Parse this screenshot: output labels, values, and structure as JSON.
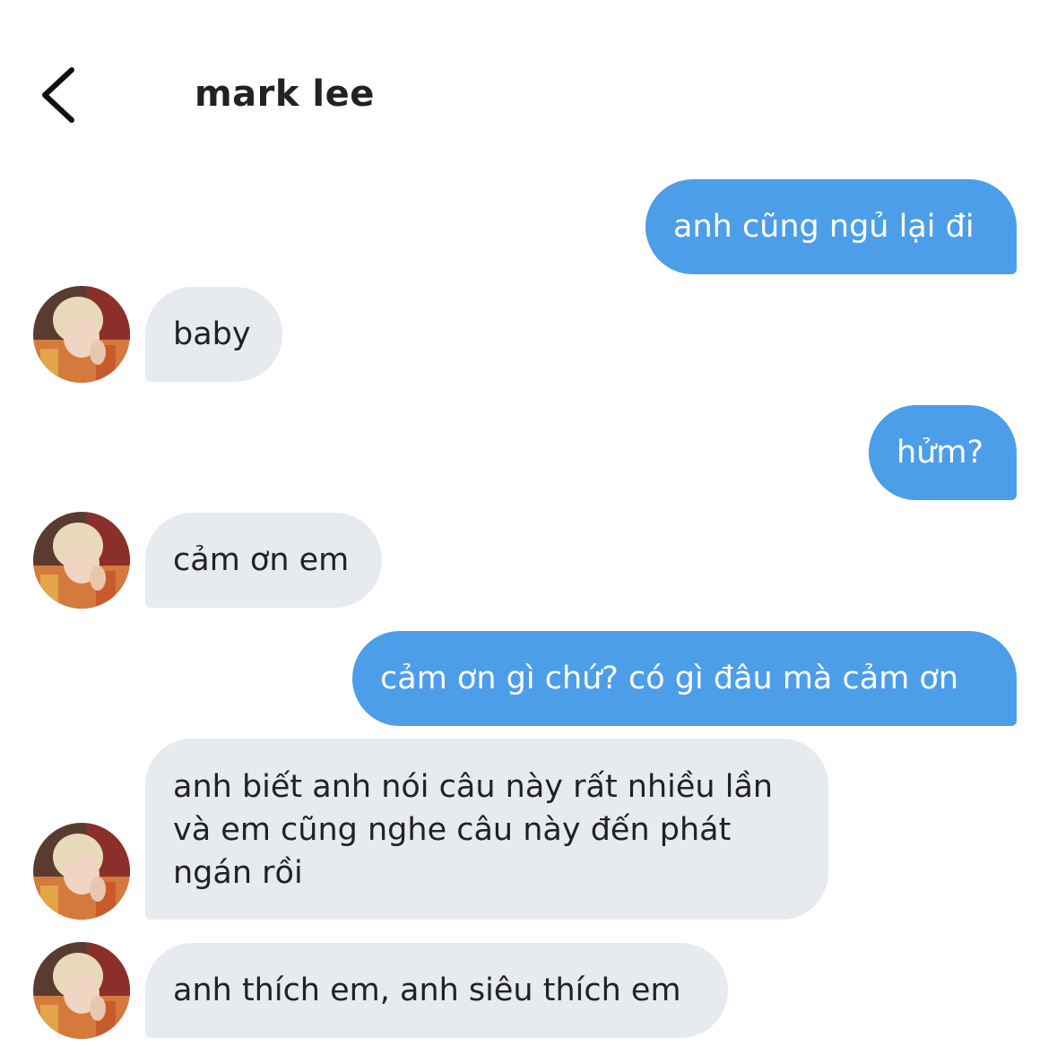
{
  "header": {
    "title": "mark lee",
    "back_icon": "chevron-left-icon"
  },
  "messages": [
    {
      "from": "me",
      "text": "anh cũng ngủ lại đi"
    },
    {
      "from": "contact",
      "text": "baby"
    },
    {
      "from": "me",
      "text": "hửm?"
    },
    {
      "from": "contact",
      "text": "cảm ơn em"
    },
    {
      "from": "me",
      "text": "cảm ơn gì chứ? có gì đâu mà cảm ơn"
    },
    {
      "from": "contact",
      "lines": [
        "anh biết anh nói câu này rất nhiều lần",
        "và em cũng nghe câu này đến phát",
        "ngán rồi"
      ]
    },
    {
      "from": "contact",
      "text": "anh thích em, anh siêu thích em"
    }
  ],
  "colors": {
    "outgoing_bubble": "#4d9ee9",
    "incoming_bubble": "#e7eaee",
    "outgoing_text": "#ffffff",
    "incoming_text": "#222222"
  }
}
